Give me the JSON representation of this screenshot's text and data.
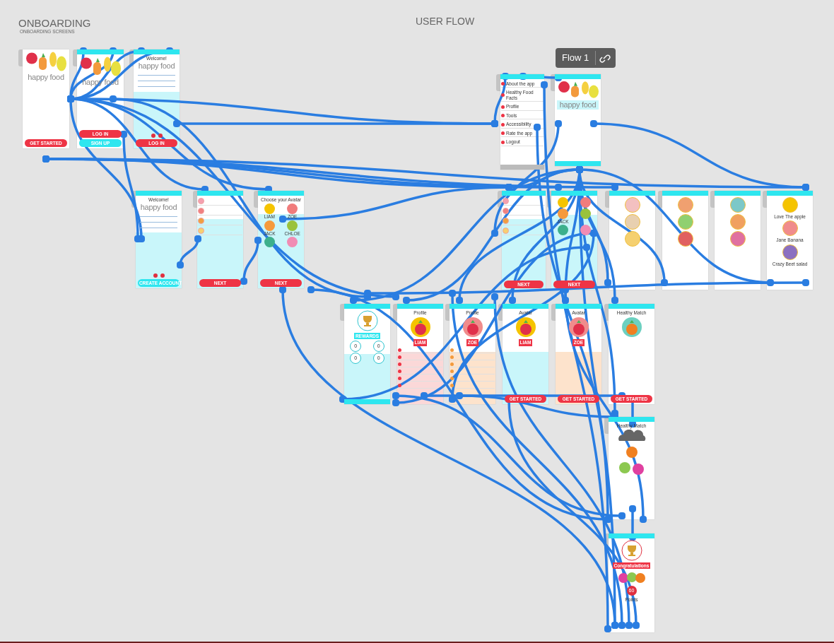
{
  "canvas_titles": [
    {
      "title": "ONBOARDING",
      "subtitle": "ONBOARDING SCREENS"
    },
    {
      "title": "USER FLOW"
    }
  ],
  "flow_tag": {
    "label": "Flow 1"
  },
  "artboards": [
    {
      "kind": "splash",
      "logo": "happy food",
      "buttons": [
        {
          "label": "GET STARTED",
          "kind": "main"
        }
      ]
    },
    {
      "kind": "splash",
      "logo": "happy food",
      "buttons": [
        {
          "label": "LOG IN",
          "kind": "main"
        },
        {
          "label": "SIGN UP",
          "kind": "alt"
        }
      ]
    },
    {
      "kind": "form",
      "logo": "happy food",
      "heading": "Welcome!",
      "buttons": [
        {
          "label": "LOG IN",
          "kind": "main"
        }
      ]
    },
    {
      "kind": "form",
      "logo": "happy food",
      "heading": "Welcome!",
      "buttons": [
        {
          "label": "CREATE ACCOUNT",
          "kind": "alt"
        }
      ]
    },
    {
      "kind": "list",
      "items": [
        {
          "color": "#f4a0b0"
        },
        {
          "color": "#f08080"
        },
        {
          "color": "#f0a040"
        },
        {
          "color": "#f7d070"
        }
      ],
      "buttons": [
        {
          "label": "NEXT",
          "kind": "main"
        }
      ]
    },
    {
      "kind": "grid",
      "heading": "Choose your Avatar",
      "items": [
        {
          "label": "LIAM",
          "color": "#f5c400"
        },
        {
          "label": "ZOE",
          "color": "#f07c7c"
        },
        {
          "label": "JACK",
          "color": "#f59a3c"
        },
        {
          "label": "CHLOE",
          "color": "#9ac23c"
        },
        {
          "color": "#3cb08c"
        },
        {
          "color": "#f08cb4"
        }
      ],
      "buttons": [
        {
          "label": "NEXT",
          "kind": "main"
        }
      ]
    },
    {
      "kind": "menu",
      "items": [
        {
          "label": "About the app"
        },
        {
          "label": "Healthy Food Facts"
        },
        {
          "label": "Profile"
        },
        {
          "label": "Tools"
        },
        {
          "label": "Accessibility"
        },
        {
          "label": "Rate the app"
        },
        {
          "label": "Logout"
        }
      ]
    },
    {
      "kind": "home",
      "logo": "happy food"
    },
    {
      "kind": "list",
      "items": [
        {
          "color": "#f4a0b0"
        },
        {
          "color": "#f08080"
        },
        {
          "color": "#f0a040"
        },
        {
          "color": "#f7d070"
        }
      ],
      "buttons": [
        {
          "label": "NEXT",
          "kind": "main"
        }
      ]
    },
    {
      "kind": "grid",
      "items": [
        {
          "color": "#f5c400"
        },
        {
          "color": "#f07c7c"
        },
        {
          "label": "JACK",
          "color": "#f59a3c"
        },
        {
          "color": "#9ac23c"
        },
        {
          "color": "#3cb08c"
        },
        {
          "color": "#f08cb4"
        }
      ],
      "buttons": [
        {
          "label": "NEXT",
          "kind": "main"
        }
      ]
    },
    {
      "kind": "feature",
      "items": [
        {
          "color": "#f3c0c0"
        },
        {
          "color": "#e8d0b0"
        },
        {
          "color": "#f5d070"
        }
      ]
    },
    {
      "kind": "feature",
      "items": [
        {
          "color": "#f0a070"
        },
        {
          "color": "#90d070"
        },
        {
          "color": "#e06060"
        }
      ]
    },
    {
      "kind": "feature",
      "items": [
        {
          "color": "#7cc8c8"
        },
        {
          "color": "#f0a060"
        },
        {
          "color": "#e070a0"
        }
      ]
    },
    {
      "kind": "feature",
      "items": [
        {
          "label": "Love The apple",
          "color": "#f5c400"
        },
        {
          "label": "Jane Banana",
          "color": "#f08c8c"
        },
        {
          "label": "Crazy Beet salad",
          "color": "#8c70c0"
        }
      ]
    },
    {
      "kind": "badge",
      "ribbon": "REWARDS",
      "stats": [
        "0",
        "0",
        "0",
        "0"
      ]
    },
    {
      "kind": "profile",
      "heading": "Profile",
      "ribbon": "LIAM",
      "color": "#fbd8d8",
      "items": [
        {
          "color": "#ee3445"
        },
        {
          "color": "#ee3445"
        },
        {
          "color": "#ee3445"
        },
        {
          "color": "#ee3445"
        },
        {
          "color": "#ee3445"
        },
        {
          "color": "#ee3445"
        }
      ]
    },
    {
      "kind": "profile",
      "heading": "Profile",
      "ribbon": "ZOE",
      "color": "#fde3cc",
      "items": [
        {
          "color": "#f39a3c"
        },
        {
          "color": "#f39a3c"
        },
        {
          "color": "#f39a3c"
        },
        {
          "color": "#f39a3c"
        },
        {
          "color": "#f39a3c"
        },
        {
          "color": "#f39a3c"
        }
      ]
    },
    {
      "kind": "avatar",
      "heading": "Avatar",
      "ribbon": "LIAM",
      "color": "#c9f6fa",
      "buttons": [
        {
          "label": "GET STARTED",
          "kind": "main"
        }
      ]
    },
    {
      "kind": "avatar",
      "heading": "Avatar",
      "ribbon": "ZOE",
      "color": "#fde3cc",
      "buttons": [
        {
          "label": "GET STARTED",
          "kind": "main"
        }
      ]
    },
    {
      "kind": "match",
      "heading": "Healthy Match",
      "buttons": [
        {
          "label": "GET STARTED",
          "kind": "main"
        }
      ]
    },
    {
      "kind": "match2",
      "heading": "Healthy Match"
    },
    {
      "kind": "congrats",
      "ribbon": "Congratulations",
      "score": "60",
      "caption": "Points"
    }
  ]
}
